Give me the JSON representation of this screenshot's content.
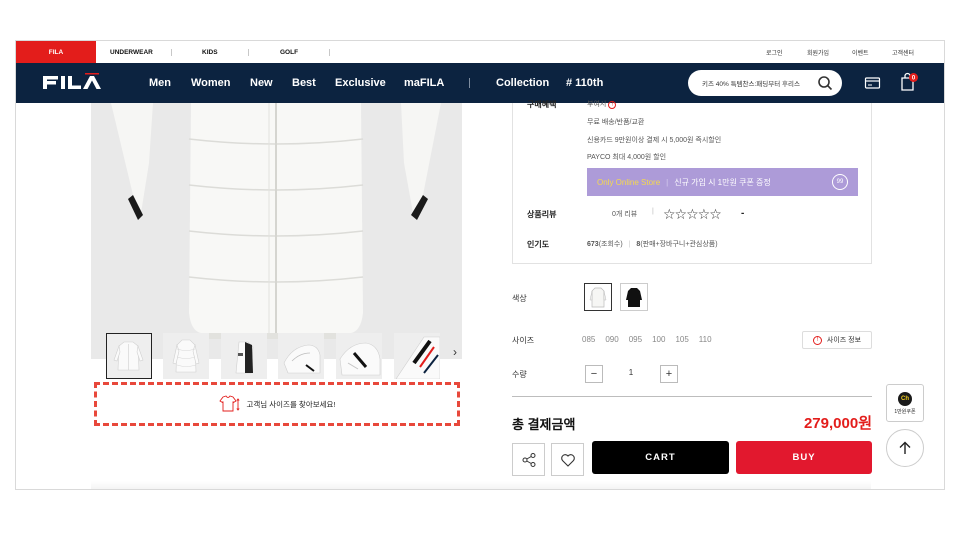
{
  "topbar": {
    "brand_tab": "FILA",
    "tabs": [
      "UNDERWEAR",
      "KIDS",
      "GOLF"
    ],
    "util_links": [
      "로그인",
      "회원가입",
      "이벤트",
      "고객센터"
    ]
  },
  "nav": {
    "logo": "FILA",
    "items": [
      "Men",
      "Women",
      "New",
      "Best",
      "Exclusive",
      "maFILA",
      "Collection",
      "# 110th"
    ],
    "search_value": "키즈 40% 특템찬스:패딩부터 후리스",
    "cart_count": "0"
  },
  "size_finder": {
    "label": "고객님 사이즈를 찾아보세요!"
  },
  "info": {
    "benefit_label": "구매혜택",
    "benefit_point": "부여시",
    "benefit_lines": [
      "무료 배송/반품/교환",
      "신용카드 9만원이상 결제 시 5,000원 즉시할인",
      "PAYCO 최대 4,000원 할인"
    ],
    "promo_left": "Only Online Store",
    "promo_right": "신규 가입 시 1만원 쿠폰 증정",
    "review_label": "상품리뷰",
    "review_count": "0개 리뷰",
    "review_score": "-",
    "rating": 0,
    "popularity_label": "인기도",
    "popularity_views": "673",
    "popularity_views_suffix": "(조회수)",
    "popularity_count": "8",
    "popularity_count_suffix": "(판매+장바구니+관심상품)"
  },
  "options": {
    "color_label": "색상",
    "size_label": "사이즈",
    "sizes": [
      "085",
      "090",
      "095",
      "100",
      "105",
      "110"
    ],
    "size_info_button": "사이즈 정보",
    "qty_label": "수량",
    "qty_value": "1",
    "minus": "−",
    "plus": "+"
  },
  "total": {
    "label": "총 결제금액",
    "value": "279,000원"
  },
  "actions": {
    "cart": "CART",
    "buy": "BUY"
  },
  "floating": {
    "coupon_badge": "Ch",
    "coupon_text": "1만원쿠폰"
  },
  "colors": {
    "brand_red": "#e31d1b",
    "navy": "#0c2340",
    "promo_purple": "#ad9bd8",
    "buy_red": "#e2182e"
  }
}
